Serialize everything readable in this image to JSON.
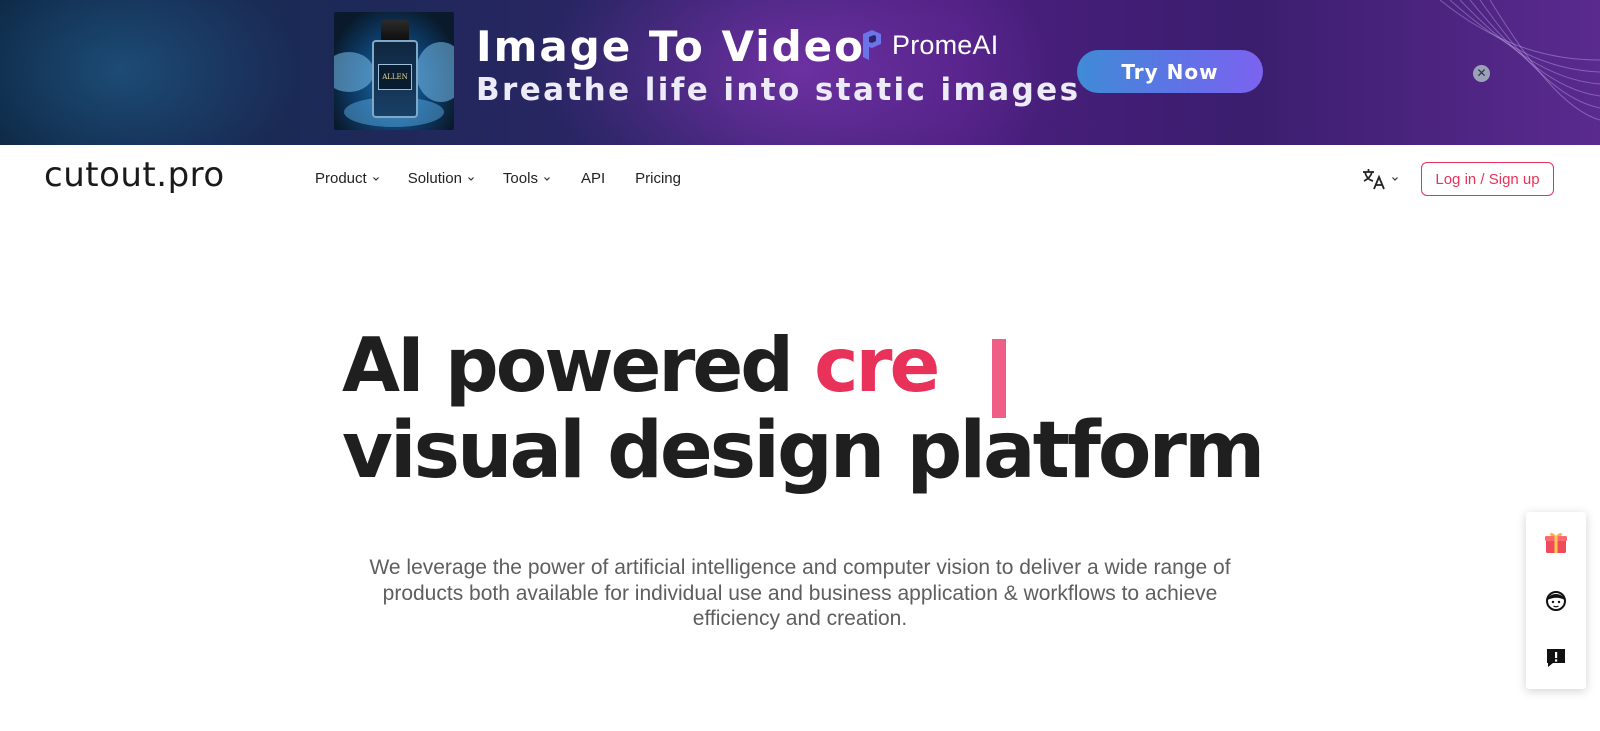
{
  "banner": {
    "title": "Image To Video",
    "subtitle": "Breathe life into static images",
    "brand": "PromeAI",
    "cta_label": "Try Now",
    "close_symbol": "✕",
    "thumb_label": "ALLEN",
    "colors": {
      "cta_start": "#3f8bd6",
      "cta_end": "#7b63f0"
    }
  },
  "nav": {
    "logo": "cutout.pro",
    "items": [
      {
        "label": "Product"
      },
      {
        "label": "Solution"
      },
      {
        "label": "Tools"
      },
      {
        "label": "API"
      },
      {
        "label": "Pricing"
      }
    ],
    "language_icon": "translate-icon",
    "login_label": "Log in / Sign up"
  },
  "hero": {
    "line1": "AI powered ",
    "accent": "cre",
    "line2": "visual design platform",
    "description": "We leverage the power of artificial intelligence and computer vision to deliver a wide range of products both available for individual use and business application & workflows to achieve efficiency and creation."
  },
  "floating": {
    "icons": [
      "gift-icon",
      "support-agent-icon",
      "feedback-icon"
    ]
  },
  "colors": {
    "accent": "#e8325a",
    "text": "#1f1f1f",
    "muted": "#5e5e5e"
  }
}
